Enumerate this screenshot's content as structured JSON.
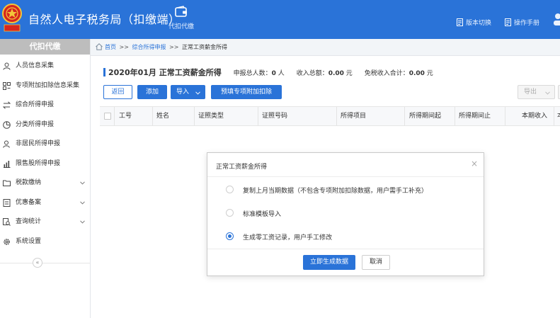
{
  "header": {
    "app_title": "自然人电子税务局（扣缴端）",
    "nav_tab_label": "代扣代缴",
    "links": {
      "version_switch": "版本切换",
      "manual": "操作手册"
    }
  },
  "sidebar": {
    "heading": "代扣代缴",
    "items": [
      {
        "label": "人员信息采集",
        "icon": "person-icon",
        "expandable": false
      },
      {
        "label": "专项附加扣除信息采集",
        "icon": "grid-icon",
        "expandable": false
      },
      {
        "label": "综合所得申报",
        "icon": "swap-icon",
        "expandable": false
      },
      {
        "label": "分类所得申报",
        "icon": "pie-icon",
        "expandable": false
      },
      {
        "label": "非居民所得申报",
        "icon": "person-outline-icon",
        "expandable": false
      },
      {
        "label": "限售股所得申报",
        "icon": "bar-chart-icon",
        "expandable": false
      },
      {
        "label": "税款缴纳",
        "icon": "folder-icon",
        "expandable": true
      },
      {
        "label": "优惠备案",
        "icon": "document-icon",
        "expandable": true
      },
      {
        "label": "查询统计",
        "icon": "search-doc-icon",
        "expandable": true
      },
      {
        "label": "系统设置",
        "icon": "gear-icon",
        "expandable": false
      }
    ],
    "collapse_glyph": "«"
  },
  "breadcrumb": {
    "home": "首页",
    "sep": ">>",
    "level2": "综合所得申报",
    "current": "正常工资薪金所得"
  },
  "page": {
    "title": "2020年01月  正常工资薪金所得",
    "stats": {
      "people_label": "申报总人数：",
      "people_value": "0",
      "people_unit": "人",
      "income_label": "收入总额：",
      "income_value": "0.00",
      "income_unit": "元",
      "exempt_label": "免税收入合计：",
      "exempt_value": "0.00",
      "exempt_unit": "元"
    }
  },
  "toolbar": {
    "back": "返回",
    "add": "添加",
    "import": "导入",
    "prefill": "预填专项附加扣除",
    "export": "导出"
  },
  "table": {
    "columns": [
      "工号",
      "姓名",
      "证照类型",
      "证照号码",
      "所得项目",
      "所得期间起",
      "所得期间止",
      "本期收入",
      "本"
    ]
  },
  "modal": {
    "title": "正常工资薪金所得",
    "close_glyph": "×",
    "options": [
      {
        "label": "复制上月当期数据（不包含专项附加扣除数据，用户需手工补充）",
        "checked": false
      },
      {
        "label": "标准模板导入",
        "checked": false
      },
      {
        "label": "生成零工资记录，用户手工修改",
        "checked": true
      }
    ],
    "confirm": "立即生成数据",
    "cancel": "取消"
  },
  "colors": {
    "brand_blue": "#2a73d8",
    "sidebar_head": "#bdbdbd",
    "emblem_red": "#d6261e",
    "emblem_gold": "#f3c53a"
  }
}
